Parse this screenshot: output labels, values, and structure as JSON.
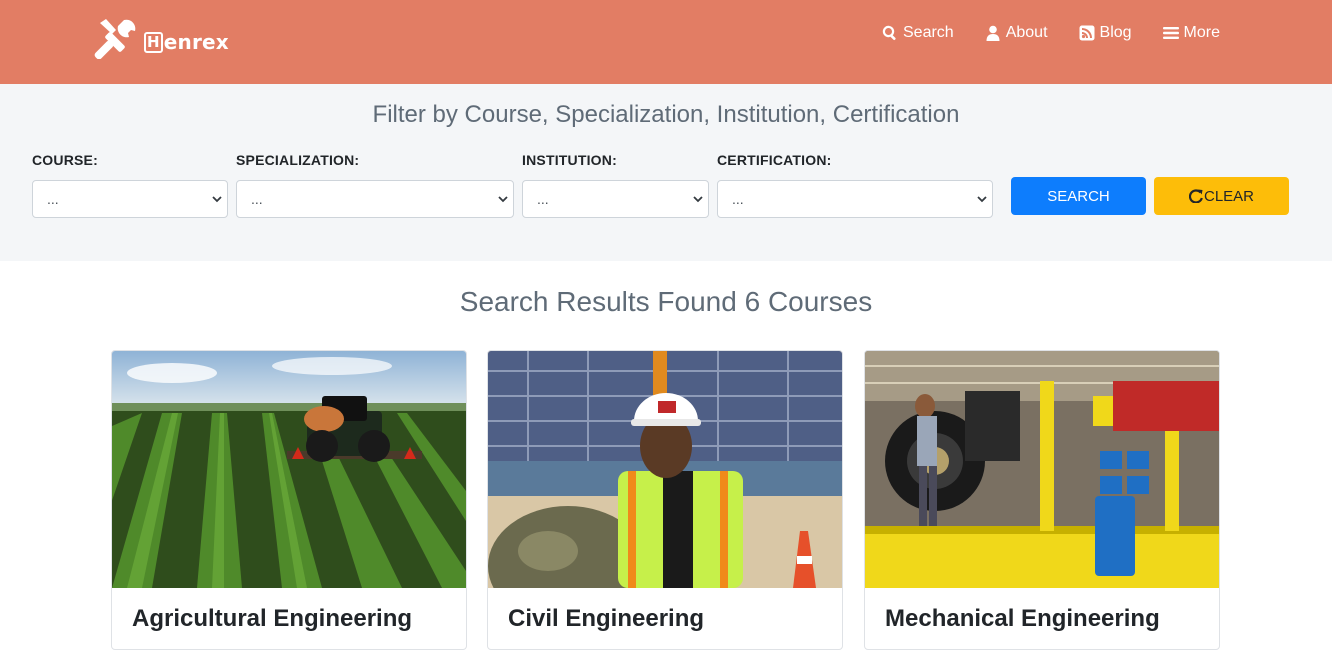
{
  "brand": {
    "name": "enrex",
    "initial": "H"
  },
  "nav": {
    "items": [
      {
        "label": "Search",
        "icon": "search-icon"
      },
      {
        "label": "About",
        "icon": "user-icon"
      },
      {
        "label": "Blog",
        "icon": "rss-icon"
      },
      {
        "label": "More",
        "icon": "bars-icon"
      }
    ]
  },
  "filter": {
    "title": "Filter by Course, Specialization, Institution, Certification",
    "fields": [
      {
        "label": "COURSE:",
        "value": "..."
      },
      {
        "label": "SPECIALIZATION:",
        "value": "..."
      },
      {
        "label": "INSTITUTION:",
        "value": "..."
      },
      {
        "label": "CERTIFICATION:",
        "value": "..."
      }
    ],
    "search_label": "SEARCH",
    "clear_label": "CLEAR"
  },
  "results": {
    "title": "Search Results Found 6 Courses",
    "cards": [
      {
        "title": "Agricultural Engineering",
        "image": "tractor-field-image"
      },
      {
        "title": "Civil Engineering",
        "image": "construction-worker-image"
      },
      {
        "title": "Mechanical Engineering",
        "image": "factory-assembly-image"
      }
    ]
  },
  "colors": {
    "header": "#e27d64",
    "filter_bg": "#f4f6f8",
    "search_button": "#0d7dfd",
    "clear_button": "#fdbd09"
  }
}
